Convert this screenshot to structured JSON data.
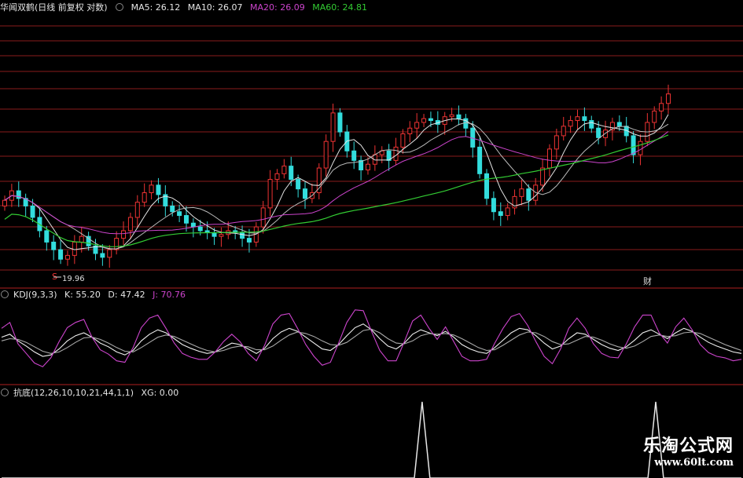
{
  "main_panel": {
    "title": "华闻双鹤(日线 前复权 对数)",
    "indicators": [
      {
        "label": "MA5: 26.12",
        "color": "#e6e6e6"
      },
      {
        "label": "MA10: 26.07",
        "color": "#e6e6e6"
      },
      {
        "label": "MA20: 26.09",
        "color": "#cc44cc"
      },
      {
        "label": "MA60: 24.81",
        "color": "#33cc33"
      }
    ],
    "low_marker": "19.96",
    "sell_marker": "S",
    "event_marker": "财"
  },
  "kdj_panel": {
    "title": "KDJ(9,3,3)",
    "values": [
      {
        "label": "K: 55.20",
        "color": "#e6e6e6"
      },
      {
        "label": "D: 47.42",
        "color": "#e6e6e6"
      },
      {
        "label": "J: 70.76",
        "color": "#cc44cc"
      }
    ]
  },
  "kangdi_panel": {
    "title": "抗底(12,26,10,10,21,44,1,1)",
    "value": "XG: 0.00"
  },
  "watermark": {
    "line1": "乐淘公式网",
    "line2": "www.60lt.com"
  },
  "colors": {
    "up": "#ee3333",
    "down": "#33dddd",
    "grid": "#8a1c1c",
    "ma60": "#33cc33",
    "ma20": "#cc44cc",
    "ma_fast": "#e6e6e6"
  },
  "chart_data": [
    {
      "type": "candlestick",
      "title": "华闻双鹤(日线 前复权 对数)",
      "lines": [
        "MA5",
        "MA10",
        "MA20",
        "MA60"
      ],
      "ma_last": {
        "MA5": 26.12,
        "MA10": 26.07,
        "MA20": 26.09,
        "MA60": 24.81
      },
      "annotated_low": 19.96,
      "close": [
        23.5,
        24.0,
        23.6,
        23.2,
        22.6,
        21.9,
        21.3,
        20.9,
        20.4,
        20.6,
        21.3,
        21.6,
        21.1,
        20.7,
        20.5,
        20.9,
        21.5,
        21.9,
        22.6,
        23.4,
        23.9,
        24.3,
        23.8,
        23.2,
        22.9,
        22.7,
        22.3,
        22.1,
        21.9,
        21.8,
        21.6,
        21.7,
        21.9,
        21.8,
        21.5,
        21.3,
        22.1,
        23.1,
        24.6,
        24.9,
        25.3,
        24.6,
        24.1,
        23.6,
        23.9,
        25.2,
        26.6,
        28.1,
        27.1,
        26.1,
        25.6,
        25.1,
        25.4,
        25.9,
        26.1,
        25.6,
        26.3,
        27.0,
        27.3,
        27.6,
        27.8,
        27.7,
        27.5,
        27.9,
        28.0,
        27.8,
        27.3,
        26.3,
        24.9,
        23.6,
        22.9,
        22.7,
        23.1,
        23.7,
        24.1,
        23.5,
        24.3,
        25.2,
        26.2,
        26.9,
        27.4,
        27.7,
        27.9,
        27.7,
        27.3,
        26.8,
        27.2,
        27.6,
        27.4,
        26.9,
        25.9,
        26.6,
        27.6,
        28.2,
        28.6,
        29.1
      ]
    },
    {
      "type": "line",
      "title": "KDJ(9,3,3)",
      "series": [
        {
          "name": "K",
          "values": [
            60,
            64,
            55,
            48,
            40,
            34,
            36,
            44,
            55,
            62,
            66,
            60,
            52,
            47,
            40,
            36,
            42,
            55,
            64,
            70,
            66,
            58,
            50,
            45,
            41,
            38,
            40,
            46,
            52,
            50,
            44,
            38,
            45,
            58,
            67,
            72,
            68,
            60,
            52,
            44,
            42,
            50,
            62,
            73,
            78,
            70,
            58,
            48,
            44,
            52,
            64,
            70,
            66,
            62,
            68,
            60,
            50,
            44,
            40,
            38,
            46,
            56,
            66,
            72,
            70,
            62,
            52,
            44,
            48,
            58,
            66,
            64,
            57,
            50,
            45,
            42,
            47,
            56,
            66,
            70,
            64,
            58,
            66,
            72,
            68,
            60,
            53,
            48,
            44,
            40,
            38
          ]
        },
        {
          "name": "D",
          "values": [
            55,
            58,
            57,
            53,
            47,
            41,
            38,
            40,
            46,
            53,
            59,
            60,
            57,
            52,
            46,
            41,
            40,
            46,
            53,
            60,
            63,
            61,
            56,
            51,
            46,
            42,
            40,
            42,
            46,
            48,
            47,
            43,
            43,
            48,
            56,
            63,
            67,
            65,
            61,
            55,
            50,
            49,
            53,
            61,
            69,
            71,
            66,
            58,
            52,
            51,
            55,
            62,
            65,
            64,
            65,
            63,
            58,
            52,
            46,
            42,
            43,
            49,
            56,
            63,
            67,
            66,
            61,
            54,
            50,
            51,
            56,
            61,
            60,
            56,
            51,
            47,
            45,
            48,
            54,
            61,
            63,
            61,
            62,
            66,
            67,
            65,
            60,
            55,
            50,
            46,
            42
          ]
        },
        {
          "name": "J",
          "values": [
            72,
            80,
            51,
            38,
            25,
            20,
            32,
            54,
            73,
            80,
            84,
            60,
            43,
            37,
            28,
            26,
            46,
            73,
            86,
            90,
            72,
            52,
            38,
            33,
            30,
            30,
            40,
            54,
            64,
            54,
            38,
            28,
            49,
            78,
            90,
            92,
            72,
            50,
            34,
            22,
            26,
            52,
            80,
            97,
            96,
            68,
            42,
            28,
            28,
            54,
            82,
            90,
            72,
            57,
            74,
            54,
            34,
            28,
            28,
            30,
            52,
            72,
            88,
            92,
            76,
            54,
            34,
            24,
            44,
            72,
            86,
            72,
            51,
            38,
            33,
            32,
            51,
            74,
            90,
            90,
            66,
            52,
            74,
            86,
            70,
            50,
            39,
            34,
            32,
            28,
            30
          ]
        }
      ]
    },
    {
      "type": "line",
      "title": "抗底(12,26,10,10,21,44,1,1)",
      "series": [
        {
          "name": "XG",
          "values": [
            0,
            0,
            0,
            0,
            0,
            0,
            0,
            0,
            0,
            0,
            0,
            0,
            0,
            0,
            0,
            0,
            0,
            0,
            0,
            0,
            0,
            0,
            0,
            0,
            0,
            0,
            0,
            0,
            0,
            0,
            0,
            0,
            0,
            0,
            0,
            0,
            0,
            0,
            0,
            0,
            0,
            0,
            0,
            0,
            0,
            0,
            0,
            0,
            0,
            0,
            0,
            0,
            0,
            0,
            1,
            0,
            0,
            0,
            0,
            0,
            0,
            0,
            0,
            0,
            0,
            0,
            0,
            0,
            0,
            0,
            0,
            0,
            0,
            0,
            0,
            0,
            0,
            0,
            0,
            0,
            0,
            0,
            0,
            0,
            1,
            0,
            0,
            0,
            0,
            0,
            0,
            0,
            0,
            0,
            0,
            0
          ]
        }
      ]
    }
  ]
}
